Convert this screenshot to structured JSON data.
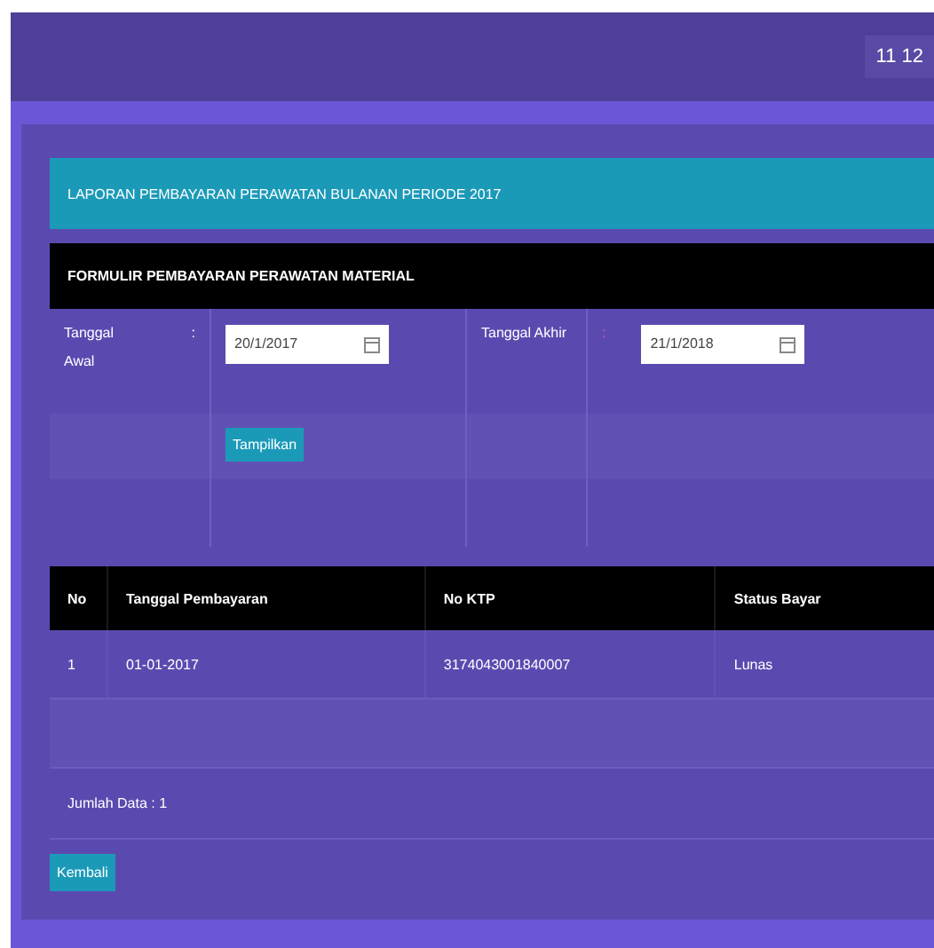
{
  "topbar": {
    "user_text": "11 12"
  },
  "alert": {
    "text": "LAPORAN PEMBAYARAN PERAWATAN BULANAN PERIODE 2017"
  },
  "form": {
    "title": "FORMULIR PEMBAYARAN PERAWATAN MATERIAL",
    "start_label": "Tanggal Awal",
    "start_colon": ":",
    "start_value": "20/1/2017",
    "end_label": "Tanggal Akhir",
    "end_colon": ":",
    "end_value": "21/1/2018",
    "submit": "Tampilkan"
  },
  "table": {
    "columns": [
      "No",
      "Tanggal Pembayaran",
      "No KTP",
      "Status Bayar"
    ],
    "rows": [
      [
        "1",
        "01-01-2017",
        "3174043001840007",
        "Lunas"
      ]
    ]
  },
  "footer_text": "Jumlah Data : 1",
  "back_button": "Kembali"
}
